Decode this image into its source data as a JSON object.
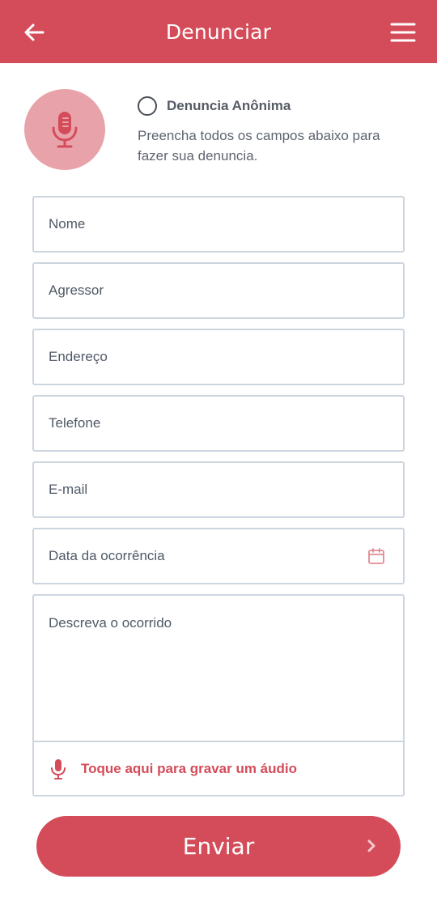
{
  "header": {
    "title": "Denunciar",
    "back_icon": "arrow-left-icon",
    "menu_icon": "hamburger-menu-icon"
  },
  "intro": {
    "mic_icon": "microphone-icon",
    "anonymous_label": "Denuncia Anônima",
    "anonymous_checked": false,
    "help_text": "Preencha todos os campos abaixo para fazer sua denuncia."
  },
  "form": {
    "nome": "Nome",
    "agressor": "Agressor",
    "endereco": "Endereço",
    "telefone": "Telefone",
    "email": "E-mail",
    "data": "Data da ocorrência",
    "descricao": "Descreva o ocorrido",
    "audio_label": "Toque aqui para gravar um áudio"
  },
  "submit": {
    "label": "Enviar"
  },
  "colors": {
    "primary": "#d44c59",
    "primary_light": "#e8a3aa",
    "border": "#cdd5df"
  }
}
